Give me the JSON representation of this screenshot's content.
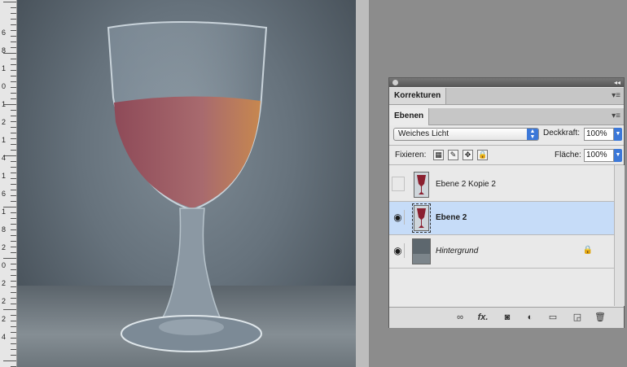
{
  "ruler": {
    "labels": [
      "6",
      "8",
      "1",
      "0",
      "1",
      "2",
      "1",
      "4",
      "1",
      "6",
      "1",
      "8",
      "2",
      "0",
      "2",
      "2",
      "2",
      "4"
    ]
  },
  "panel": {
    "tab_korrekturen": "Korrekturen",
    "tab_ebenen": "Ebenen",
    "blend_mode": "Weiches Licht",
    "opacity_label": "Deckkraft:",
    "opacity_value": "100%",
    "lock_label": "Fixieren:",
    "fill_label": "Fläche:",
    "fill_value": "100%",
    "layers": [
      {
        "name": "Ebene 2 Kopie 2",
        "visible": false,
        "selected": false
      },
      {
        "name": "Ebene 2",
        "visible": true,
        "selected": true
      },
      {
        "name": "Hintergrund",
        "visible": true,
        "selected": false,
        "locked": true
      }
    ],
    "bottom_icons": [
      "link-icon",
      "fx-icon",
      "mask-icon",
      "adjustment-icon",
      "folder-icon",
      "new-layer-icon",
      "trash-icon"
    ],
    "fx_label": "fx."
  },
  "colors": {
    "selection": "#c6dcf8",
    "accent": "#3c78d8"
  }
}
